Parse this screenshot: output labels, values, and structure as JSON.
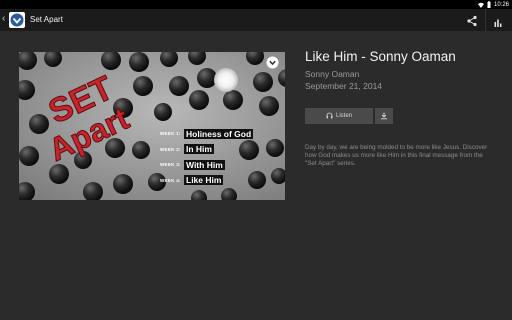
{
  "status_bar": {
    "time": "10:26"
  },
  "action_bar": {
    "title": "Set Apart"
  },
  "icons": {
    "back": "chevron-left-icon",
    "app": "church-logo-icon",
    "share": "share-icon",
    "stats": "bar-chart-icon",
    "check": "chevron-down-circle-icon",
    "listen": "headphones-icon",
    "download": "download-icon"
  },
  "artwork": {
    "series_title_line1": "SET",
    "series_title_line2": "Apart",
    "weeks": [
      {
        "number": "WEEK 1:",
        "title": "Holiness of God"
      },
      {
        "number": "WEEK 2:",
        "title": "In Him"
      },
      {
        "number": "WEEK 3:",
        "title": "With Him"
      },
      {
        "number": "WEEK 4:",
        "title": "Like Him"
      }
    ]
  },
  "episode": {
    "title": "Like Him - Sonny Oaman",
    "speaker": "Sonny Oaman",
    "date": "September 21, 2014",
    "listen_label": "Listen",
    "description": "Day by day, we are being molded to be more like Jesus. Discover how God makes us more like Him in this final message from the \"Set Apart\" series."
  },
  "colors": {
    "background": "#2b2b2b",
    "action_bar": "#1b1b1b",
    "status_bar": "#000000",
    "button": "#4a4a4a",
    "artwork_red": "#c8232c"
  }
}
